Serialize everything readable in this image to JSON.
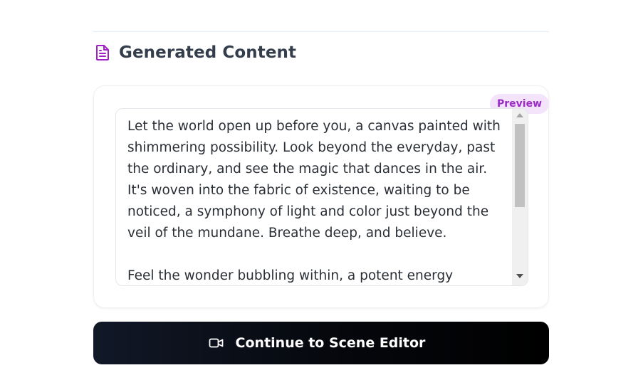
{
  "section": {
    "icon": "document-icon",
    "title": "Generated Content"
  },
  "preview": {
    "badge_label": "Preview",
    "text": "Let the world open up before you, a canvas painted with shimmering possibility. Look beyond the everyday, past the ordinary, and see the magic that dances in the air. It's woven into the fabric of existence, waiting to be noticed, a symphony of light and color just beyond the veil of the mundane. Breathe deep, and believe.\n\nFeel the wonder bubbling within, a potent energy yearning"
  },
  "cta": {
    "icon": "video-camera-icon",
    "label": "Continue to Scene Editor"
  },
  "colors": {
    "accent": "#9b2bc4",
    "badge_bg": "#f3e4fb",
    "title_text": "#333d4b",
    "button_bg": "#000000"
  }
}
